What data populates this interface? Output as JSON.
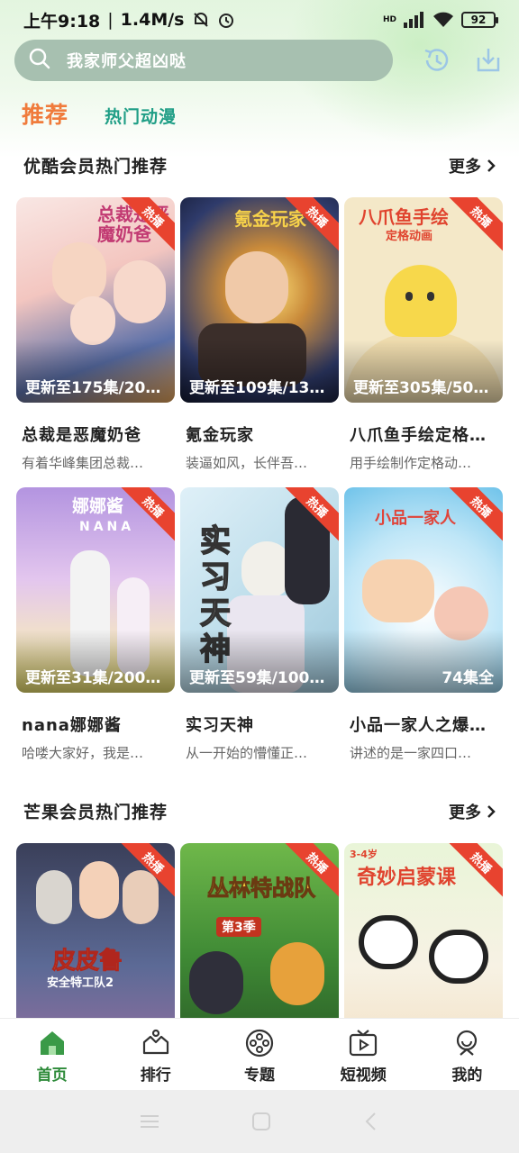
{
  "status_bar": {
    "time": "上午9:18",
    "net_speed": "1.4M/s",
    "hd_label": "HD",
    "battery": "92",
    "icons": [
      "mute-icon",
      "alarm-icon",
      "signal-icon",
      "wifi-icon",
      "battery-icon"
    ]
  },
  "search": {
    "placeholder": "我家师父超凶哒"
  },
  "header_icons": [
    "history-icon",
    "download-icon"
  ],
  "tabs": [
    {
      "label": "推荐",
      "active": true
    },
    {
      "label": "热门动漫",
      "active": false
    }
  ],
  "sections": [
    {
      "title": "优酷会员热门推荐",
      "more": "更多",
      "items": [
        {
          "title": "总裁是恶魔奶爸",
          "desc": "有着华峰集团总裁…",
          "update": "更新至175集/20…",
          "badge": "热播",
          "poster_text": "总裁是恶魔奶爸"
        },
        {
          "title": "氪金玩家",
          "desc": "装逼如风，长伴吾…",
          "update": "更新至109集/13…",
          "badge": "热播",
          "poster_text": "氪金玩家"
        },
        {
          "title": "八爪鱼手绘定格…",
          "desc": "用手绘制作定格动…",
          "update": "更新至305集/50…",
          "badge": "热播",
          "poster_text": "八爪鱼手绘",
          "poster_sub": "定格动画"
        }
      ]
    },
    {
      "items": [
        {
          "title": "nana娜娜酱",
          "desc": "哈喽大家好，我是…",
          "update": "更新至31集/200…",
          "badge": "热播",
          "poster_text": "娜娜酱",
          "poster_sub": "NANA"
        },
        {
          "title": "实习天神",
          "desc": "从一开始的懵懂正…",
          "update": "更新至59集/100…",
          "badge": "热播",
          "poster_text": "实习天神"
        },
        {
          "title": "小品一家人之爆…",
          "desc": "讲述的是一家四口…",
          "update": "74集全",
          "badge": "热播",
          "poster_text": "小品一家人"
        }
      ]
    },
    {
      "title": "芒果会员热门推荐",
      "more": "更多",
      "items": [
        {
          "badge": "热播",
          "poster_text": "皮皮鲁",
          "poster_sub": "安全特工队2"
        },
        {
          "badge": "热播",
          "poster_text": "丛林特战队",
          "poster_sub": "第3季"
        },
        {
          "badge": "热播",
          "poster_text": "奇妙启蒙课",
          "poster_sub": "3-4岁"
        }
      ]
    }
  ],
  "bottom_nav": [
    {
      "label": "首页",
      "icon": "home-icon",
      "active": true
    },
    {
      "label": "排行",
      "icon": "ranking-icon",
      "active": false
    },
    {
      "label": "专题",
      "icon": "film-reel-icon",
      "active": false
    },
    {
      "label": "短视频",
      "icon": "tv-play-icon",
      "active": false
    },
    {
      "label": "我的",
      "icon": "profile-icon",
      "active": false
    }
  ],
  "colors": {
    "accent_green": "#2e8b3a",
    "tab_orange": "#f07b3c",
    "tab_teal": "#1f9e86",
    "badge_red": "#e8432f"
  }
}
